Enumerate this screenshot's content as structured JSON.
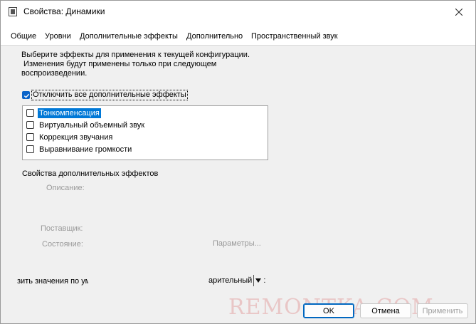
{
  "window": {
    "title": "Свойства: Динамики",
    "icon": "speaker-icon",
    "close_glyph": "✕"
  },
  "tabs": [
    {
      "label": "Общие"
    },
    {
      "label": "Уровни"
    },
    {
      "label": "Дополнительные эффекты",
      "active": true
    },
    {
      "label": "Дополнительно"
    },
    {
      "label": "Пространственный звук"
    }
  ],
  "panel": {
    "description": [
      "Выберите эффекты для применения к текущей конфигурации.",
      " Изменения будут применены только при следующем",
      "воспроизведении."
    ],
    "disable_all": {
      "label": "Отключить все дополнительные эффекты",
      "checked": true
    },
    "effects": [
      {
        "label": "Тонкомпенсация",
        "checked": false,
        "selected": true
      },
      {
        "label": "Виртуальный объемный звук",
        "checked": false,
        "selected": false
      },
      {
        "label": "Коррекция звучания",
        "checked": false,
        "selected": false
      },
      {
        "label": "Выравнивание громкости",
        "checked": false,
        "selected": false
      }
    ],
    "properties": {
      "title": "Свойства дополнительных эффектов",
      "description_label": "Описание:",
      "provider_label": "Поставщик:",
      "state_label": "Состояние:",
      "settings_button": "Параметры..."
    },
    "restore_defaults": "зить значения по ум",
    "preview": {
      "text": "арительный",
      "colon": ":"
    }
  },
  "buttons": {
    "ok": "OK",
    "cancel": "Отмена",
    "apply": "Применить"
  },
  "watermark": "REMONTKA.COM",
  "colors": {
    "accent": "#0078d7",
    "check": "#0a64c9",
    "disabled_text": "#9a9a9a"
  }
}
